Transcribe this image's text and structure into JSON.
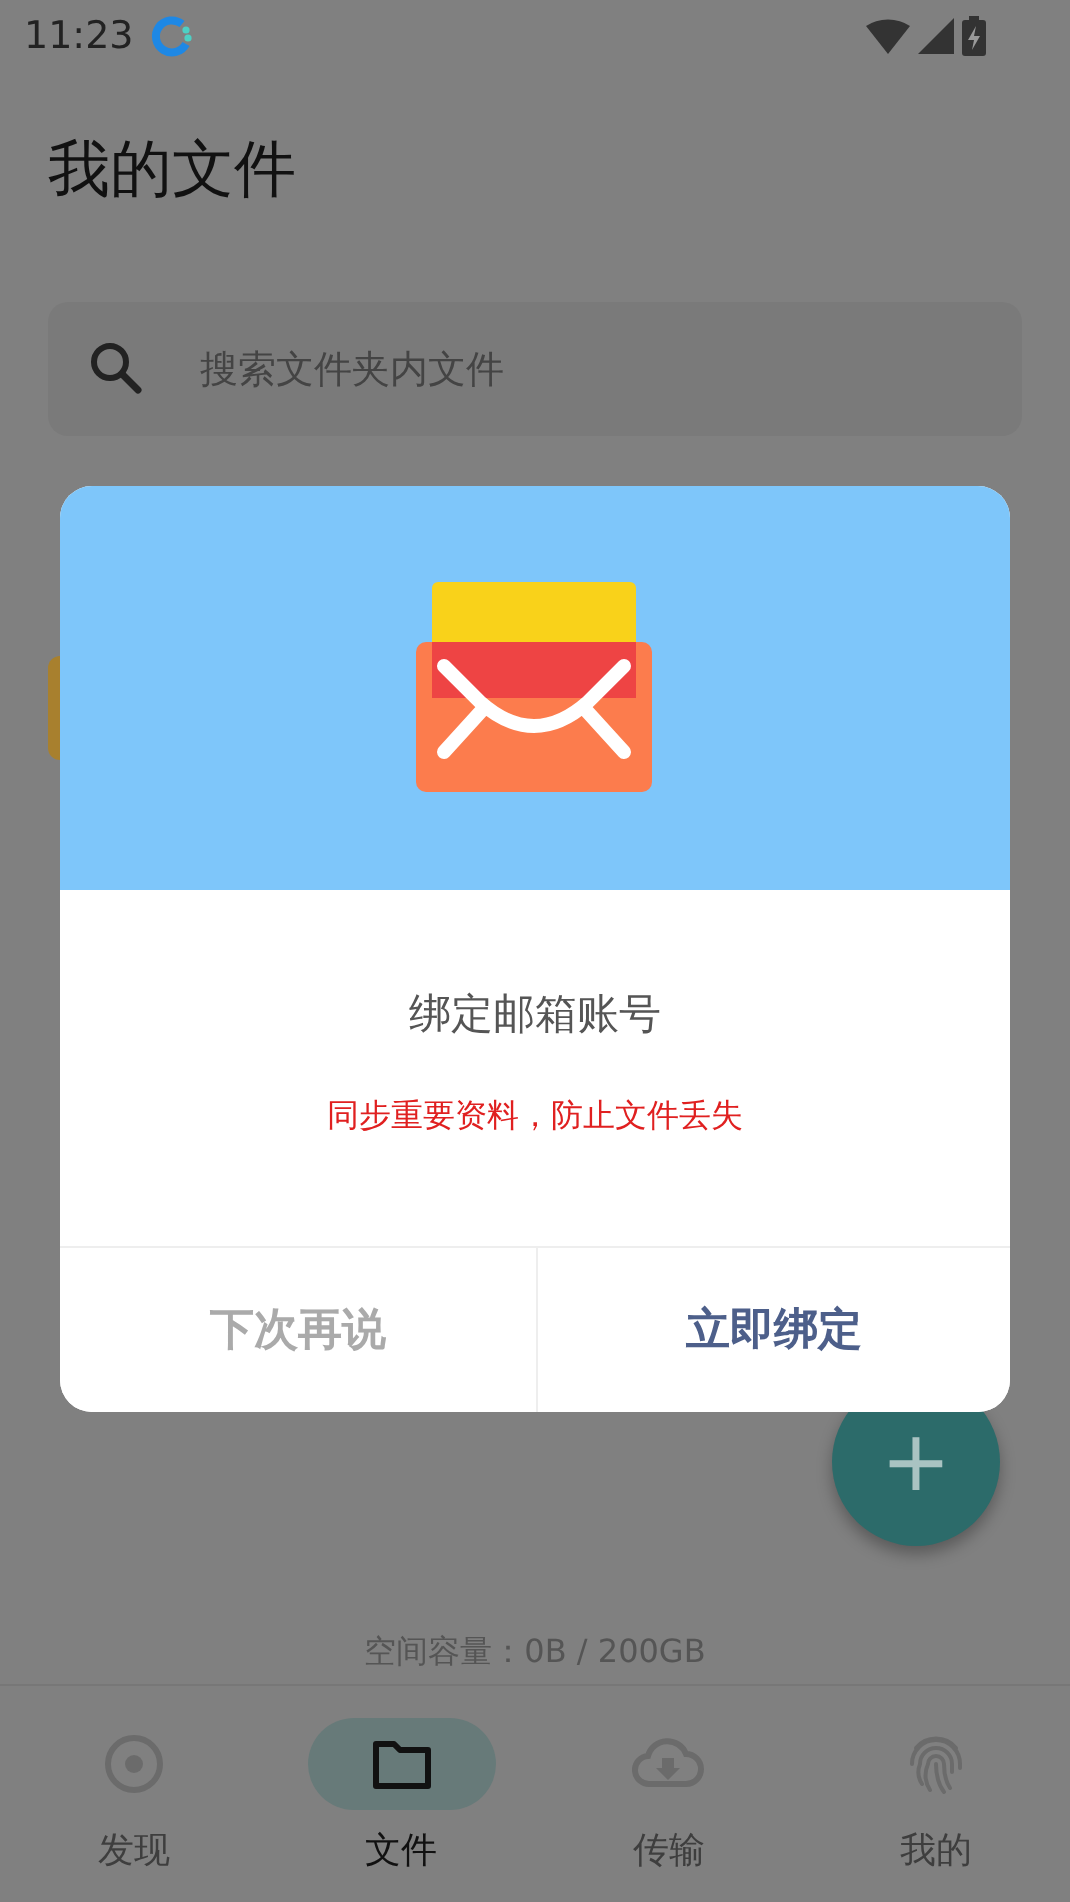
{
  "status_bar": {
    "time": "11:23"
  },
  "title": "我的文件",
  "search": {
    "placeholder": "搜索文件夹内文件"
  },
  "storage": "空间容量：0B / 200GB",
  "nav": [
    {
      "label": "发现",
      "selected": false
    },
    {
      "label": "文件",
      "selected": true
    },
    {
      "label": "传输",
      "selected": false
    },
    {
      "label": "我的",
      "selected": false
    }
  ],
  "fab": {
    "symbol": "+"
  },
  "dialog": {
    "title": "绑定邮箱账号",
    "message": "同步重要资料，防止文件丢失",
    "buttons": [
      {
        "label": "下次再说",
        "kind": "secondary"
      },
      {
        "label": "立即绑定",
        "kind": "primary"
      }
    ]
  }
}
